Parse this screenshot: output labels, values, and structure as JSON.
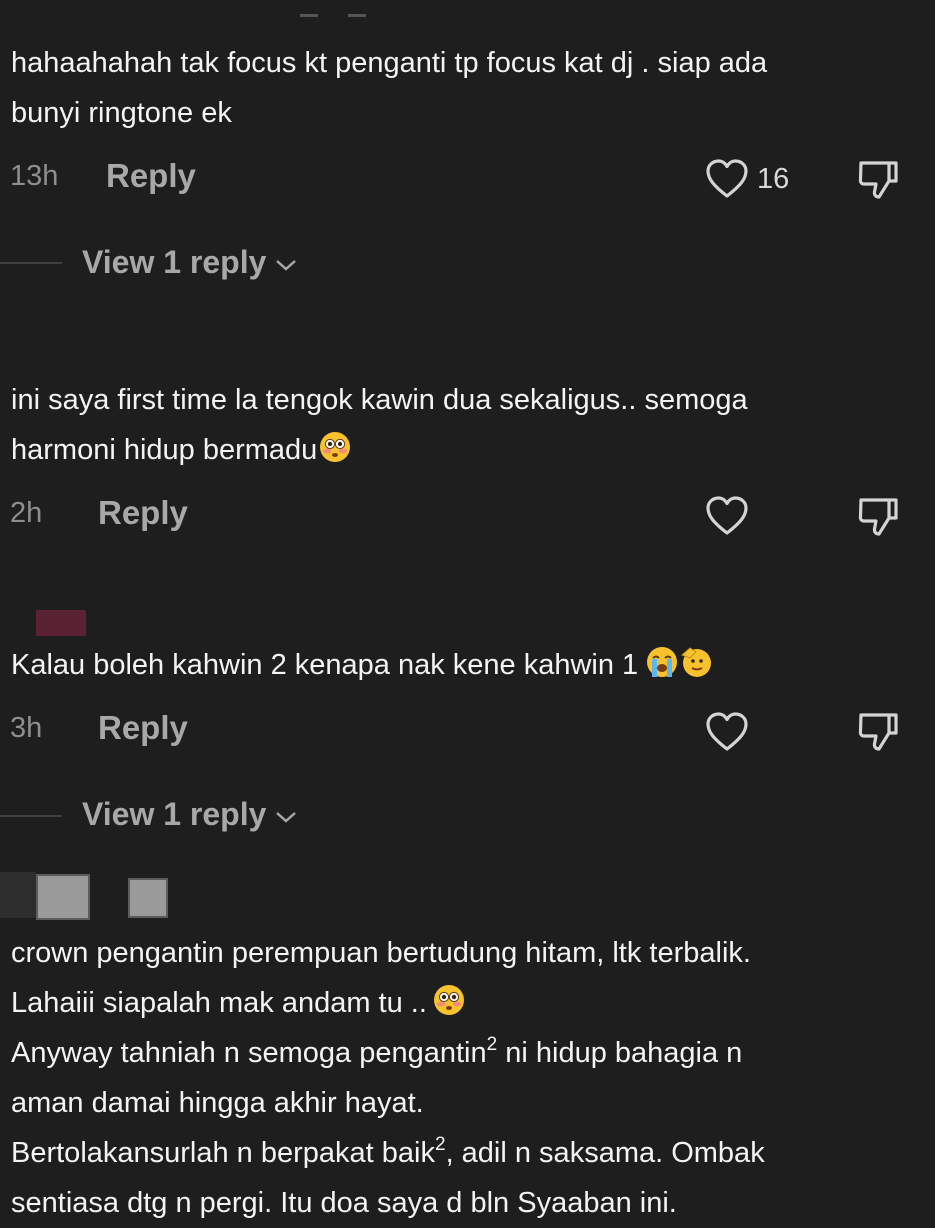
{
  "comments": [
    {
      "lines": [
        "hahaahahah tak focus kt penganti tp focus kat dj . siap ada",
        "bunyi ringtone ek"
      ],
      "time": "13h",
      "reply_label": "Reply",
      "likes": "16",
      "view_replies": "View 1 reply"
    },
    {
      "lines": [
        "ini saya first time la tengok kawin dua sekaligus.. semoga",
        "harmoni hidup bermadu"
      ],
      "time": "2h",
      "reply_label": "Reply"
    },
    {
      "lines": [
        "Kalau boleh kahwin 2 kenapa nak kene kahwin 1"
      ],
      "time": "3h",
      "reply_label": "Reply",
      "view_replies": "View 1 reply"
    },
    {
      "lines": [
        "crown pengantin perempuan bertudung hitam, ltk terbalik.",
        "Lahaiii siapalah mak andam tu ..",
        "Anyway tahniah n semoga pengantin",
        "ni hidup bahagia n",
        "aman damai hingga akhir hayat.",
        "Bertolakansurlah n berpakat baik",
        ", adil n saksama. Ombak",
        "sentiasa dtg n pergi. Itu doa saya d bln Syaaban ini."
      ],
      "superscript": "2"
    }
  ],
  "colors": {
    "background": "#1e1e1e",
    "text": "#f4f4f4",
    "muted": "#8e8e8e",
    "reply": "#a8a8a8"
  },
  "icons": [
    "heart-icon",
    "dislike-icon",
    "chevron-down-icon",
    "flushed-face-emoji",
    "crying-face-emoji",
    "saluting-face-emoji"
  ]
}
